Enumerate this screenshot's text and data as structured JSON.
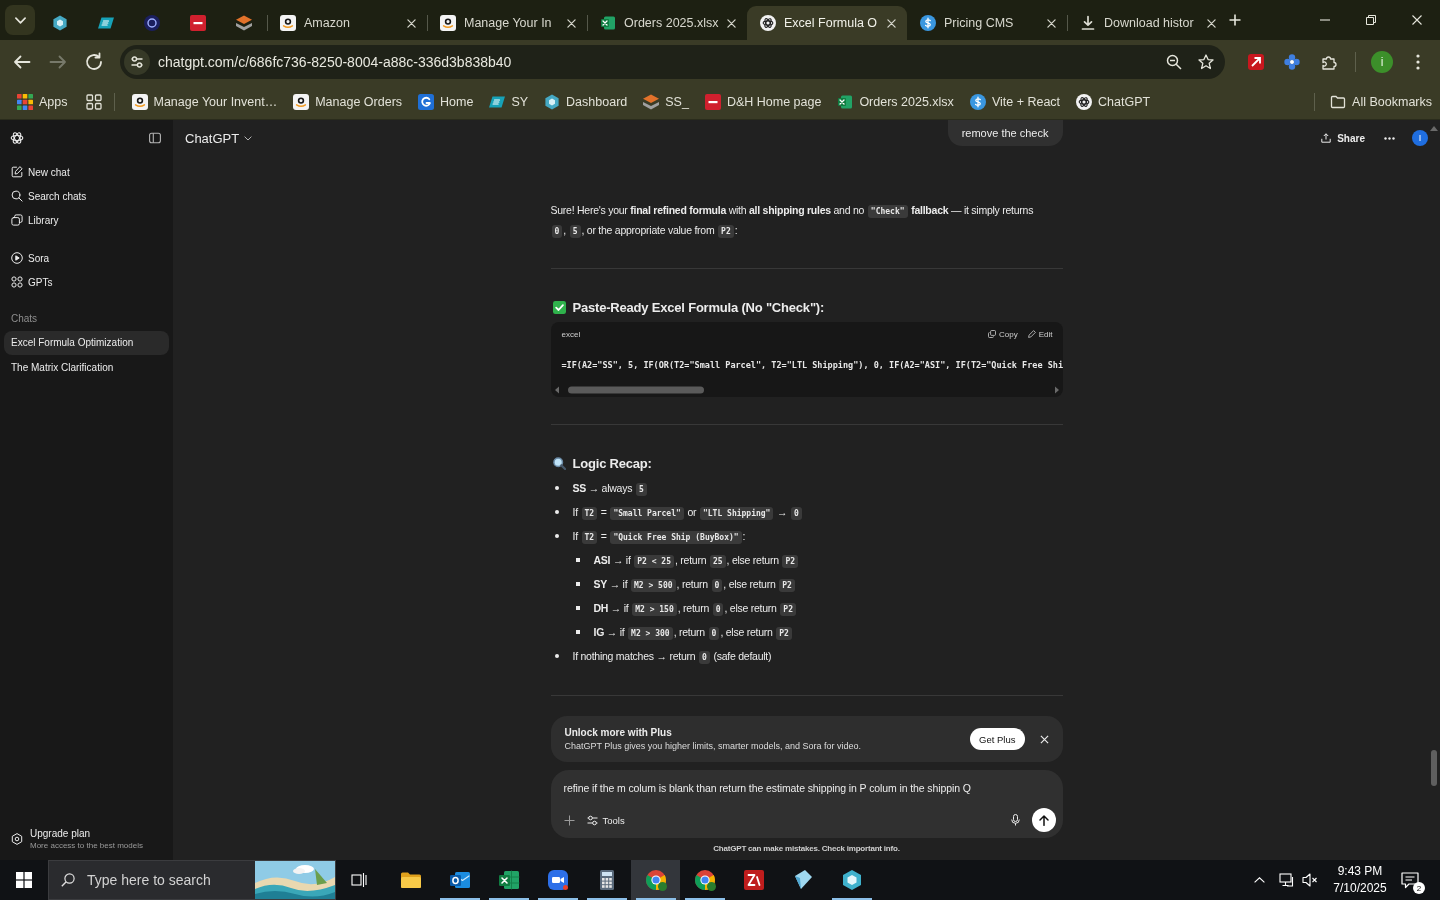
{
  "browser": {
    "tabs": [
      {
        "kind": "hexagon",
        "selected": false
      },
      {
        "kind": "badge",
        "selected": false
      },
      {
        "kind": "disc",
        "selected": false
      },
      {
        "kind": "square",
        "selected": false
      },
      {
        "kind": "stack",
        "selected": false
      },
      {
        "kind": "smile",
        "title": "Amazon",
        "selected": false
      },
      {
        "kind": "smile",
        "title": "Manage Your In",
        "selected": false
      },
      {
        "kind": "sheet",
        "title": "Orders 2025.xlsx",
        "selected": false
      },
      {
        "kind": "knot",
        "title": "Excel Formula O",
        "selected": true
      },
      {
        "kind": "dollar",
        "title": "Pricing CMS",
        "selected": false
      },
      {
        "kind": "download",
        "title": "Download histor",
        "selected": false
      }
    ],
    "navigation": [
      {
        "kind": "back",
        "disabled": false
      },
      {
        "kind": "forward",
        "disabled": true
      },
      {
        "kind": "reload",
        "disabled": false
      }
    ],
    "address": "chatgpt.com/c/686fc736-8250-8004-a88c-336d3b838b40",
    "profile_initial": "i",
    "apps": "Apps",
    "bookmarks": [
      {
        "kind": "smile",
        "title": "Manage Your Invent…"
      },
      {
        "kind": "smile",
        "title": "Manage Orders"
      },
      {
        "kind": "swirl",
        "title": "Home"
      },
      {
        "kind": "badge",
        "title": "SY"
      },
      {
        "kind": "hexagon",
        "title": "Dashboard"
      },
      {
        "kind": "stack",
        "title": "SS_"
      },
      {
        "kind": "square",
        "title": "D&H Home page"
      },
      {
        "kind": "sheet",
        "title": "Orders 2025.xlsx"
      },
      {
        "kind": "dollar",
        "title": "Vite + React"
      },
      {
        "kind": "knot",
        "title": "ChatGPT"
      }
    ],
    "all_bookmarks": "All Bookmarks"
  },
  "chatgpt": {
    "sidebar": {
      "nav": [
        {
          "kind": "pencil",
          "label": "New chat"
        },
        {
          "kind": "search",
          "label": "Search chats"
        },
        {
          "kind": "images",
          "label": "Library"
        }
      ],
      "explore": [
        {
          "kind": "play",
          "label": "Sora"
        },
        {
          "kind": "dots",
          "label": "GPTs"
        }
      ],
      "chats_heading": "Chats",
      "chats": [
        {
          "title": "Excel Formula Optimization",
          "selected": true
        },
        {
          "title": "The Matrix Clarification",
          "selected": false
        }
      ],
      "upgrade": {
        "title": "Upgrade plan",
        "subtitle": "More access to the best models"
      }
    },
    "header": {
      "model": "ChatGPT",
      "share": "Share",
      "avatar_initial": "I"
    },
    "conversation": {
      "user_message": "remove the check",
      "intro": [
        {
          "kind": "text",
          "text": "Sure! Here's your **final refined formula** with **all shipping rules** and no "
        },
        {
          "kind": "code",
          "text": "\"Check\""
        },
        {
          "kind": "text",
          "text": " **fallback** — it simply returns "
        },
        {
          "kind": "code",
          "text": "0"
        },
        {
          "kind": "text",
          "text": ", "
        },
        {
          "kind": "code",
          "text": "5"
        },
        {
          "kind": "text",
          "text": ", or the appropriate value from "
        },
        {
          "kind": "code",
          "text": "P2"
        },
        {
          "kind": "text",
          "text": ":"
        }
      ],
      "sections": [
        {
          "kind": "code",
          "heading": "Paste-Ready Excel Formula (No \"Check\"):",
          "language": "excel",
          "actions": [
            {
              "kind": "copy",
              "label": "Copy"
            },
            {
              "kind": "edit",
              "label": "Edit"
            }
          ],
          "code": "=IF(A2=\"SS\", 5, IF(OR(T2=\"Small Parcel\", T2=\"LTL Shipping\"), 0, IF(A2=\"ASI\", IF(T2=\"Quick Free Shi"
        },
        {
          "kind": "list",
          "heading": "Logic Recap:",
          "items": [
            {
              "segments": [
                {
                  "kind": "text",
                  "text": "**SS** → always "
                },
                {
                  "kind": "code",
                  "text": "5"
                }
              ]
            },
            {
              "segments": [
                {
                  "kind": "text",
                  "text": "If "
                },
                {
                  "kind": "code",
                  "text": "T2"
                },
                {
                  "kind": "text",
                  "text": " = "
                },
                {
                  "kind": "code",
                  "text": "\"Small Parcel\""
                },
                {
                  "kind": "text",
                  "text": " or "
                },
                {
                  "kind": "code",
                  "text": "\"LTL Shipping\""
                },
                {
                  "kind": "text",
                  "text": " → "
                },
                {
                  "kind": "code",
                  "text": "0"
                }
              ]
            },
            {
              "segments": [
                {
                  "kind": "text",
                  "text": "If "
                },
                {
                  "kind": "code",
                  "text": "T2"
                },
                {
                  "kind": "text",
                  "text": " = "
                },
                {
                  "kind": "code",
                  "text": "\"Quick Free Ship (BuyBox)\""
                },
                {
                  "kind": "text",
                  "text": ":"
                }
              ],
              "children": [
                {
                  "segments": [
                    {
                      "kind": "text",
                      "text": "**ASI** → if "
                    },
                    {
                      "kind": "code",
                      "text": "P2 < 25"
                    },
                    {
                      "kind": "text",
                      "text": ", return "
                    },
                    {
                      "kind": "code",
                      "text": "25"
                    },
                    {
                      "kind": "text",
                      "text": ", else return "
                    },
                    {
                      "kind": "code",
                      "text": "P2"
                    }
                  ]
                },
                {
                  "segments": [
                    {
                      "kind": "text",
                      "text": "**SY** → if "
                    },
                    {
                      "kind": "code",
                      "text": "M2 > 500"
                    },
                    {
                      "kind": "text",
                      "text": ", return "
                    },
                    {
                      "kind": "code",
                      "text": "0"
                    },
                    {
                      "kind": "text",
                      "text": ", else return "
                    },
                    {
                      "kind": "code",
                      "text": "P2"
                    }
                  ]
                },
                {
                  "segments": [
                    {
                      "kind": "text",
                      "text": "**DH** → if "
                    },
                    {
                      "kind": "code",
                      "text": "M2 > 150"
                    },
                    {
                      "kind": "text",
                      "text": ", return "
                    },
                    {
                      "kind": "code",
                      "text": "0"
                    },
                    {
                      "kind": "text",
                      "text": ", else return "
                    },
                    {
                      "kind": "code",
                      "text": "P2"
                    }
                  ]
                },
                {
                  "segments": [
                    {
                      "kind": "text",
                      "text": "**IG** → if "
                    },
                    {
                      "kind": "code",
                      "text": "M2 > 300"
                    },
                    {
                      "kind": "text",
                      "text": ", return "
                    },
                    {
                      "kind": "code",
                      "text": "0"
                    },
                    {
                      "kind": "text",
                      "text": ", else return "
                    },
                    {
                      "kind": "code",
                      "text": "P2"
                    }
                  ]
                }
              ]
            },
            {
              "segments": [
                {
                  "kind": "text",
                  "text": "If nothing matches → return "
                },
                {
                  "kind": "code",
                  "text": "0"
                },
                {
                  "kind": "text",
                  "text": " (safe default)"
                }
              ]
            }
          ]
        }
      ]
    },
    "upsell": {
      "title": "Unlock more with Plus",
      "text": "ChatGPT Plus gives you higher limits, smarter models, and Sora for video.",
      "button": "Get Plus"
    },
    "composer": {
      "value": "refine if the m colum is blank than return the estimate shipping in P colum in the shippin Q",
      "tools": "Tools"
    },
    "disclaimer": "ChatGPT can make mistakes. Check important info."
  },
  "taskbar": {
    "search_placeholder": "Type here to search",
    "apps": [
      {
        "kind": "folder",
        "selected": false,
        "running": false
      },
      {
        "kind": "mail",
        "selected": false,
        "running": true
      },
      {
        "kind": "sheet",
        "selected": false,
        "running": true
      },
      {
        "kind": "camera",
        "selected": false,
        "running": true
      },
      {
        "kind": "calculator",
        "selected": false,
        "running": true
      },
      {
        "kind": "wheel",
        "selected": true,
        "running": true
      },
      {
        "kind": "wheel",
        "selected": false,
        "running": true
      },
      {
        "kind": "zigzag",
        "selected": false,
        "running": false
      },
      {
        "kind": "prism",
        "selected": false,
        "running": false
      },
      {
        "kind": "hexagon",
        "selected": false,
        "running": true
      }
    ],
    "time": "9:43 PM",
    "date": "7/10/2025",
    "notifications": "2"
  }
}
